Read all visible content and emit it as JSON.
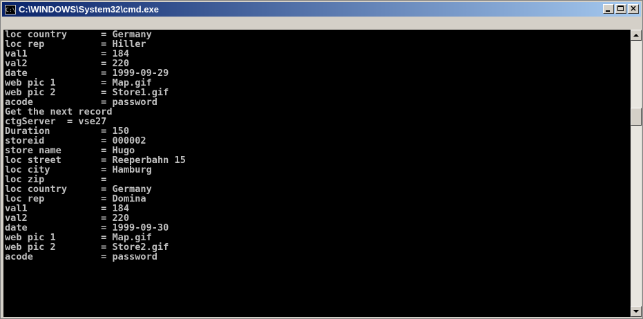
{
  "window": {
    "title": "C:\\WINDOWS\\System32\\cmd.exe",
    "icon": "cmd-icon",
    "icon_text": "C:\\"
  },
  "colors": {
    "titlebar_start": "#0a246a",
    "titlebar_end": "#a6caf0",
    "console_bg": "#000000",
    "console_text": "#c0c0c0"
  },
  "controls": {
    "minimize": "minimize-icon",
    "maximize": "maximize-icon",
    "close": "close-icon",
    "close_glyph": "×"
  },
  "console": {
    "lines": [
      "loc country      = Germany",
      "loc rep          = Hiller",
      "val1             = 184",
      "val2             = 220",
      "date             = 1999-09-29",
      "web pic 1        = Map.gif",
      "web pic 2        = Store1.gif",
      "acode            = password",
      "Get the next record",
      "ctgServer  = vse27",
      "Duration         = 150",
      "storeid          = 000002",
      "store name       = Hugo",
      "loc street       = Reeperbahn 15",
      "loc city         = Hamburg",
      "loc zip          =",
      "loc country      = Germany",
      "loc rep          = Domina",
      "val1             = 184",
      "val2             = 220",
      "date             = 1999-09-30",
      "web pic 1        = Map.gif",
      "web pic 2        = Store2.gif",
      "acode            = password"
    ]
  },
  "scrollbar": {
    "up_icon": "scroll-up-arrow-icon",
    "down_icon": "scroll-down-arrow-icon",
    "position": 0.27
  }
}
